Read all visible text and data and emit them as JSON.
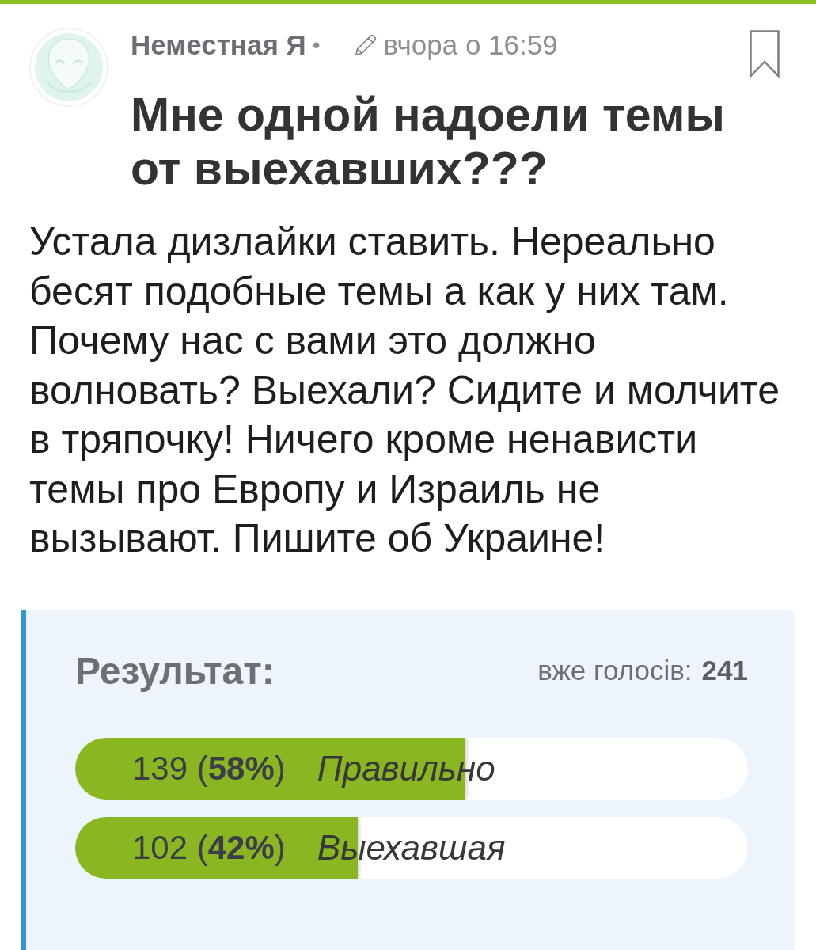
{
  "post": {
    "author": "Неместная Я",
    "separator": "•",
    "time": "вчора о 16:59",
    "bookmarked": false,
    "title": "Мне одной надоели темы от выехавших???",
    "body": "Устала дизлайки ставить. Нереально бесят подобные темы а как у них там. Почему нас с вами это должно волновать? Выехали? Сидите и молчите в тряпочку! Ничего кроме ненависти темы про Европу и Израиль не вызывают. Пишите об Украине!"
  },
  "poll": {
    "heading": "Результат:",
    "total_label": "вже голосів:",
    "total": "241",
    "options": [
      {
        "votes": "139 (**58%**)",
        "label": "Правильно",
        "level": 0.58
      },
      {
        "votes": "102 (**42%**)",
        "label": "Выехавшая",
        "level": 0.42
      }
    ]
  }
}
